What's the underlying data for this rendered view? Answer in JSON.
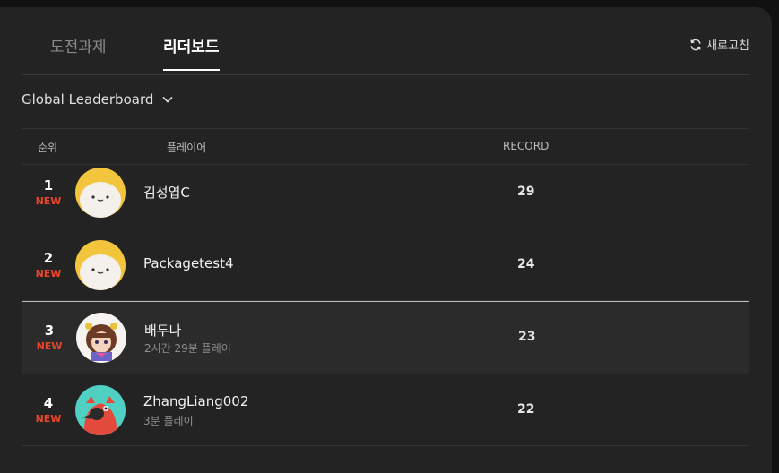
{
  "tabs": [
    "도전과제",
    "리더보드"
  ],
  "refresh_label": "새로고침",
  "dropdown_label": "Global Leaderboard",
  "columns": {
    "rank": "순위",
    "player": "플레이어",
    "record": "RECORD"
  },
  "rows": [
    {
      "rank": "1",
      "badge": "NEW",
      "name": "김성엽C",
      "sub": "",
      "record": "29"
    },
    {
      "rank": "2",
      "badge": "NEW",
      "name": "Packagetest4",
      "sub": "",
      "record": "24"
    },
    {
      "rank": "3",
      "badge": "NEW",
      "name": "배두나",
      "sub": "2시간 29분 플레이",
      "record": "23"
    },
    {
      "rank": "4",
      "badge": "NEW",
      "name": "ZhangLiang002",
      "sub": "3분 플레이",
      "record": "22"
    }
  ],
  "colors": {
    "accent_new": "#e8452c",
    "panel": "#232323",
    "selected_border": "#bdbdbd"
  }
}
